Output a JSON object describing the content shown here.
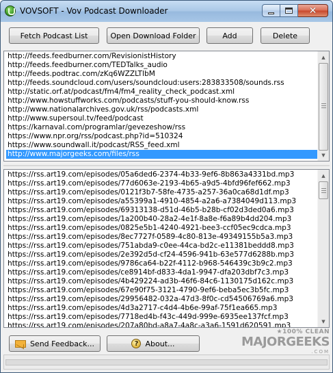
{
  "window": {
    "title": "VOVSOFT - Vov Podcast Downloader"
  },
  "toolbar": {
    "fetch_label": "Fetch Podcast List",
    "open_folder_label": "Open Download Folder",
    "add_label": "Add",
    "delete_label": "Delete"
  },
  "feeds": {
    "items": [
      "http://feeds.feedburner.com/RevisionistHistory",
      "http://feeds.feedburner.com/TEDTalks_audio",
      "http://feeds.podtrac.com/zKq6WZZLTlbM",
      "http://feeds.soundcloud.com/users/soundcloud:users:283833508/sounds.rss",
      "http://static.orf.at/podcast/fm4/fm4_reality_check_podcast.xml",
      "http://www.howstuffworks.com/podcasts/stuff-you-should-know.rss",
      "http://www.nationalarchives.gov.uk/rss/podcasts.xml",
      "http://www.supersoul.tv/feed/podcast",
      "https://karnaval.com/programlar/gevezeshow/rss",
      "https://www.npr.org/rss/podcast.php?id=510324",
      "https://www.soundwall.it/podcast/RSS_feed.xml",
      "http://www.majorgeeks.com/files/rss"
    ],
    "selected_index": 11
  },
  "episodes": {
    "items": [
      "https://rss.art19.com/episodes/05a6ded6-2374-4b33-9ef6-8b863a4331bd.mp3",
      "https://rss.art19.com/episodes/77d6063e-2193-4b65-a9d5-4bfd96fef662.mp3",
      "https://rss.art19.com/episodes/0121f3b7-58fe-4735-a257-36a0ca68d1df.mp3",
      "https://rss.art19.com/episodes/a55399a1-4910-4854-a2a6-a7384049d113.mp3",
      "https://rss.art19.com/episodes/69313138-d51d-46b5-b28b-cf02d3ded0a6.mp3",
      "https://rss.art19.com/episodes/1a200b40-28a2-4e1f-8a8e-f6a89b4dd204.mp3",
      "https://rss.art19.com/episodes/0825e5b1-4240-4921-bee3-ccf05ec9cdca.mp3",
      "https://rss.art19.com/episodes/8ec7727f-0589-4c80-813e-49349155b5a3.mp3",
      "https://rss.art19.com/episodes/751abda9-c0ee-44ca-bd2c-e11381beddd8.mp3",
      "https://rss.art19.com/episodes/2e392d5d-cf24-4596-941b-63e577d6288b.mp3",
      "https://rss.art19.com/episodes/9786ca64-b22f-4112-b968-546439c3b9c2.mp3",
      "https://rss.art19.com/episodes/ce8914bf-d833-4da1-9947-dfa203dbf7c3.mp3",
      "https://rss.art19.com/episodes/4b429224-ad3b-46f6-84c6-1130175d162c.mp3",
      "https://rss.art19.com/episodes/67e90f75-3121-4790-9ef6-beba5ec3b5fc.mp3",
      "https://rss.art19.com/episodes/29956482-032a-47d3-8f0c-cd54506769a6.mp3",
      "https://rss.art19.com/episodes/4d3a2717-c4d4-4b6e-99af-75f1ea665.mp3",
      "https://rss.art19.com/episodes/7718ed4b-f43c-449d-999e-6935ee137fcf.mp3",
      "https://rss.art19.com/episodes/207a80bd-a8a7-4a8c-a3a6-1591d620591.mp3"
    ]
  },
  "footer": {
    "feedback_label": "Send Feedback...",
    "about_label": "About..."
  },
  "watermark": {
    "line1": "★100% CLEAN",
    "line2": "MAJORGEEKS",
    "line3": ".COM"
  },
  "colors": {
    "selection": "#3399ff",
    "close_button": "#c7452a"
  }
}
